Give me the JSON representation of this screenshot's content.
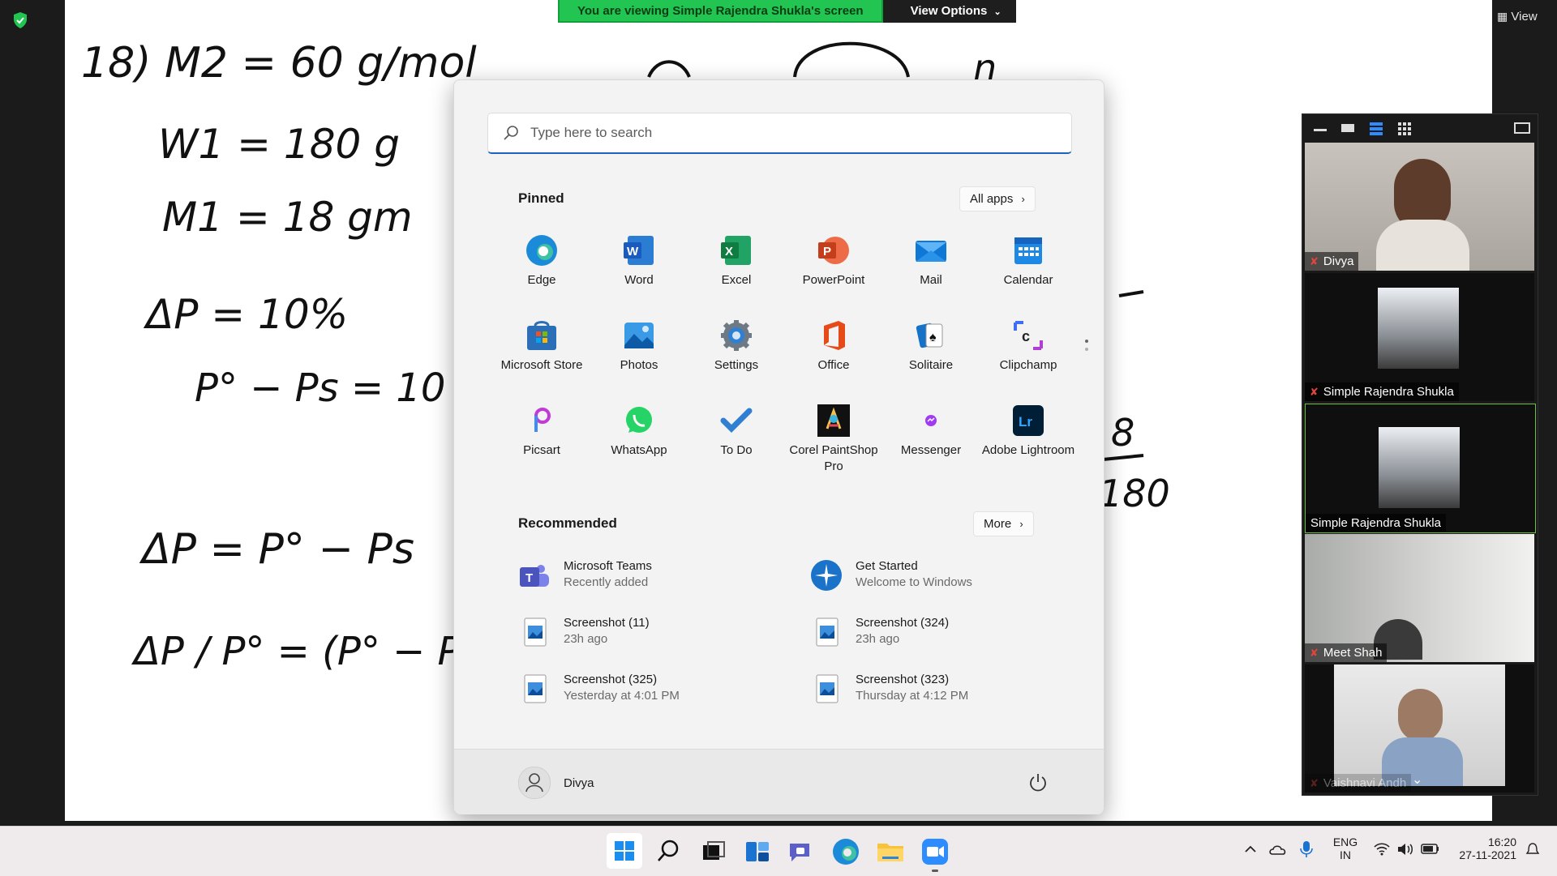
{
  "meeting": {
    "share_message": "You are viewing Simple Rajendra Shukla's screen",
    "view_options_label": "View Options",
    "view_label": "View"
  },
  "whiteboard": {
    "lines": [
      "18) M2 = 60 g/mol",
      "W1 = 180 g",
      "M1 = 18 gm",
      "ΔP = 10%",
      "P° − Ps = 10",
      "ΔP = P° − Ps",
      "ΔP / P° = (P° − Ps) / P°"
    ]
  },
  "participants": [
    {
      "name": "Divya",
      "muted": true
    },
    {
      "name": "Simple Rajendra Shukla",
      "muted": true
    },
    {
      "name": "Simple Rajendra Shukla",
      "muted": false
    },
    {
      "name": "Meet Shah",
      "muted": true
    },
    {
      "name": "Vaishnavi Andh",
      "muted": true
    }
  ],
  "start_menu": {
    "search_placeholder": "Type here to search",
    "pinned_title": "Pinned",
    "all_apps_label": "All apps",
    "pinned_apps": [
      {
        "label": "Edge",
        "icon": "edge-icon"
      },
      {
        "label": "Word",
        "icon": "word-icon"
      },
      {
        "label": "Excel",
        "icon": "excel-icon"
      },
      {
        "label": "PowerPoint",
        "icon": "powerpoint-icon"
      },
      {
        "label": "Mail",
        "icon": "mail-icon"
      },
      {
        "label": "Calendar",
        "icon": "calendar-icon"
      },
      {
        "label": "Microsoft Store",
        "icon": "store-icon"
      },
      {
        "label": "Photos",
        "icon": "photos-icon"
      },
      {
        "label": "Settings",
        "icon": "gear-icon"
      },
      {
        "label": "Office",
        "icon": "office-icon"
      },
      {
        "label": "Solitaire",
        "icon": "cards-icon"
      },
      {
        "label": "Clipchamp",
        "icon": "clipchamp-icon"
      },
      {
        "label": "Picsart",
        "icon": "picsart-icon"
      },
      {
        "label": "WhatsApp",
        "icon": "whatsapp-icon"
      },
      {
        "label": "To Do",
        "icon": "checkmark-icon"
      },
      {
        "label": "Corel PaintShop Pro",
        "icon": "paintshop-icon"
      },
      {
        "label": "Messenger",
        "icon": "messenger-icon"
      },
      {
        "label": "Adobe Lightroom",
        "icon": "lightroom-icon"
      }
    ],
    "recommended_title": "Recommended",
    "more_label": "More",
    "recommended": [
      {
        "title": "Microsoft Teams",
        "subtitle": "Recently added",
        "icon": "teams-icon"
      },
      {
        "title": "Get Started",
        "subtitle": "Welcome to Windows",
        "icon": "get-started-icon"
      },
      {
        "title": "Screenshot (11)",
        "subtitle": "23h ago",
        "icon": "image-file-icon"
      },
      {
        "title": "Screenshot (324)",
        "subtitle": "23h ago",
        "icon": "image-file-icon"
      },
      {
        "title": "Screenshot (325)",
        "subtitle": "Yesterday at 4:01 PM",
        "icon": "image-file-icon"
      },
      {
        "title": "Screenshot (323)",
        "subtitle": "Thursday at 4:12 PM",
        "icon": "image-file-icon"
      }
    ],
    "user_name": "Divya"
  },
  "taskbar": {
    "apps": [
      "start-icon",
      "search-icon",
      "task-view-icon",
      "widgets-icon",
      "chat-icon",
      "edge-icon",
      "file-explorer-icon",
      "zoom-icon"
    ],
    "language": "ENG",
    "region": "IN",
    "time": "16:20",
    "date": "27-11-2021"
  },
  "colors": {
    "accent": "#1d64b8",
    "share_bar": "#23c552",
    "start_bg": "#f3f3f3",
    "taskbar_bg": "#efeaeb"
  }
}
